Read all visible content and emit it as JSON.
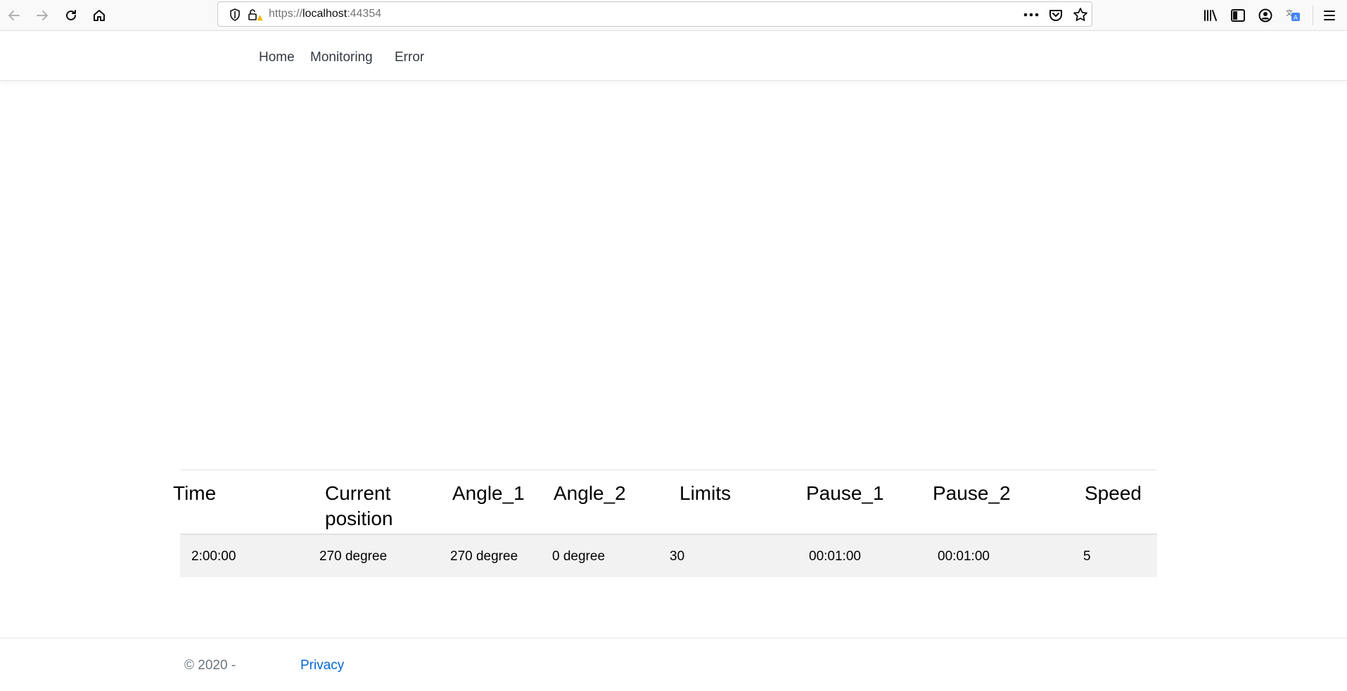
{
  "browser": {
    "url_scheme": "https://",
    "url_host": "localhost",
    "url_port": ":44354"
  },
  "nav": {
    "links": [
      "Home",
      "Monitoring",
      "Error"
    ]
  },
  "table": {
    "headers": [
      "Time",
      "Current position",
      "Angle_1",
      "Angle_2",
      "Limits",
      "Pause_1",
      "Pause_2",
      "Speed"
    ],
    "rows": [
      [
        "2:00:00",
        "270 degree",
        "270 degree",
        "0 degree",
        "30",
        "00:01:00",
        "00:01:00",
        "5"
      ]
    ]
  },
  "footer": {
    "copyright": "© 2020 -",
    "privacy_label": "Privacy"
  },
  "colors": {
    "link": "#0366d6",
    "row_stripe": "#f2f2f2"
  }
}
